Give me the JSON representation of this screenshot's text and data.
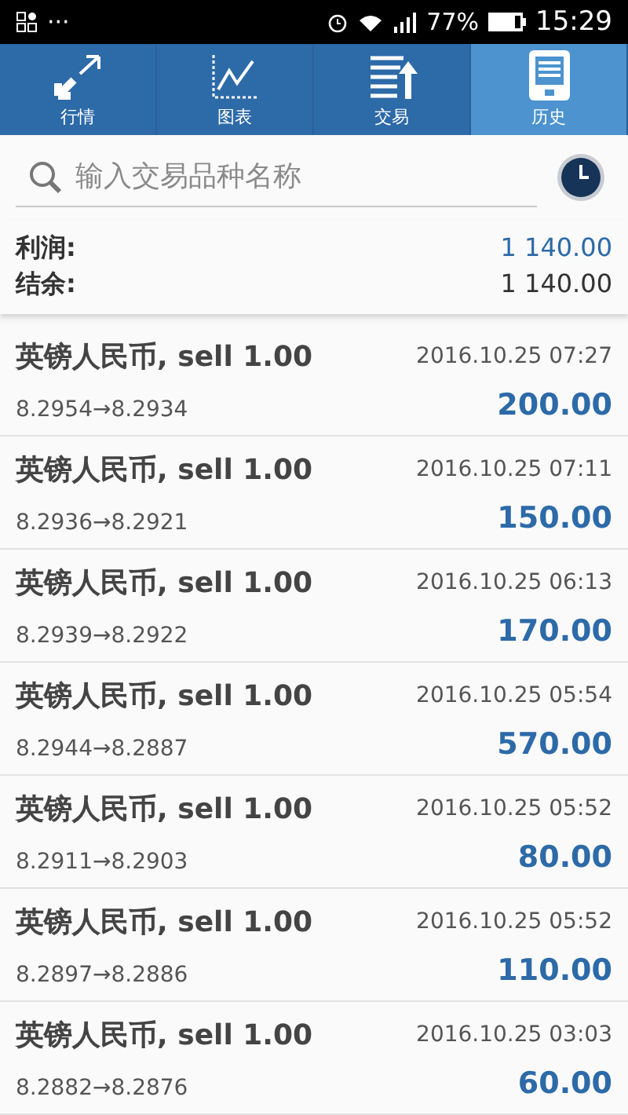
{
  "status_bar": {
    "more": "···",
    "battery": "77%",
    "time": "15:29"
  },
  "tabs": [
    {
      "label": "行情",
      "kind": "arrows",
      "selected": false
    },
    {
      "label": "图表",
      "kind": "chart",
      "selected": false
    },
    {
      "label": "交易",
      "kind": "trade",
      "selected": false
    },
    {
      "label": "历史",
      "kind": "history",
      "selected": true
    }
  ],
  "search": {
    "placeholder": "输入交易品种名称"
  },
  "summary": [
    {
      "label": "利润:",
      "value": "1 140.00",
      "kind": "profit"
    },
    {
      "label": "结余:",
      "value": "1 140.00",
      "kind": "balance"
    }
  ],
  "trades": [
    {
      "title": "英镑人民币, sell 1.00",
      "time": "2016.10.25 07:27",
      "prices": "8.2954→8.2934",
      "profit": "200.00"
    },
    {
      "title": "英镑人民币, sell 1.00",
      "time": "2016.10.25 07:11",
      "prices": "8.2936→8.2921",
      "profit": "150.00"
    },
    {
      "title": "英镑人民币, sell 1.00",
      "time": "2016.10.25 06:13",
      "prices": "8.2939→8.2922",
      "profit": "170.00"
    },
    {
      "title": "英镑人民币, sell 1.00",
      "time": "2016.10.25 05:54",
      "prices": "8.2944→8.2887",
      "profit": "570.00"
    },
    {
      "title": "英镑人民币, sell 1.00",
      "time": "2016.10.25 05:52",
      "prices": "8.2911→8.2903",
      "profit": "80.00"
    },
    {
      "title": "英镑人民币, sell 1.00",
      "time": "2016.10.25 05:52",
      "prices": "8.2897→8.2886",
      "profit": "110.00"
    },
    {
      "title": "英镑人民币, sell 1.00",
      "time": "2016.10.25 03:03",
      "prices": "8.2882→8.2876",
      "profit": "60.00"
    }
  ]
}
